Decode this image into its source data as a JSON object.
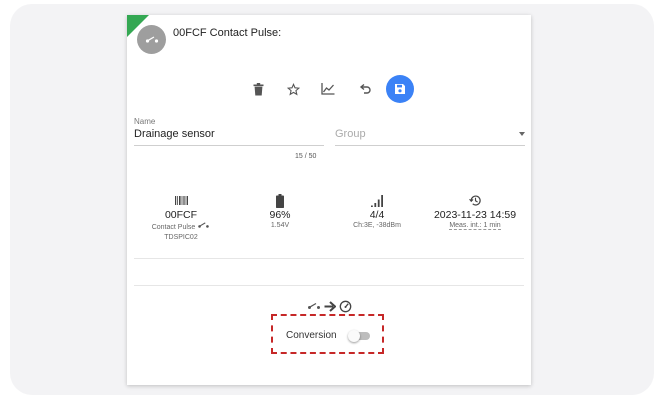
{
  "device": {
    "title": "00FCF Contact Pulse:",
    "avatar_icon": "contact-pulse-icon",
    "corner_color": "#34a853"
  },
  "toolbar": {
    "buttons": [
      {
        "name": "delete-button",
        "icon": "trash-icon"
      },
      {
        "name": "favorite-button",
        "icon": "star-icon"
      },
      {
        "name": "chart-button",
        "icon": "chart-icon"
      },
      {
        "name": "undo-button",
        "icon": "undo-icon"
      },
      {
        "name": "save-button",
        "icon": "save-icon",
        "color": "#3b82f6"
      }
    ]
  },
  "form": {
    "name_label": "Name",
    "name_value": "Drainage sensor",
    "name_counter": "15 / 50",
    "group_placeholder": "Group"
  },
  "stats": {
    "id": {
      "icon": "barcode-icon",
      "value": "00FCF",
      "type_label": "Contact Pulse",
      "type_icon": "contact-pulse-icon",
      "model": "TDSPIC02"
    },
    "battery": {
      "icon": "battery-icon",
      "value": "96%",
      "voltage": "1.54V"
    },
    "signal": {
      "icon": "signal-icon",
      "value": "4/4",
      "detail": "Ch:3E, -38dBm"
    },
    "time": {
      "icon": "history-icon",
      "value": "2023-11-23 14:59",
      "interval": "Meas. int.: 1 min"
    }
  },
  "conversion": {
    "flow_icons": [
      "contact-pulse-icon",
      "arrow-right-icon",
      "gauge-icon"
    ],
    "label": "Conversion",
    "enabled": false
  }
}
